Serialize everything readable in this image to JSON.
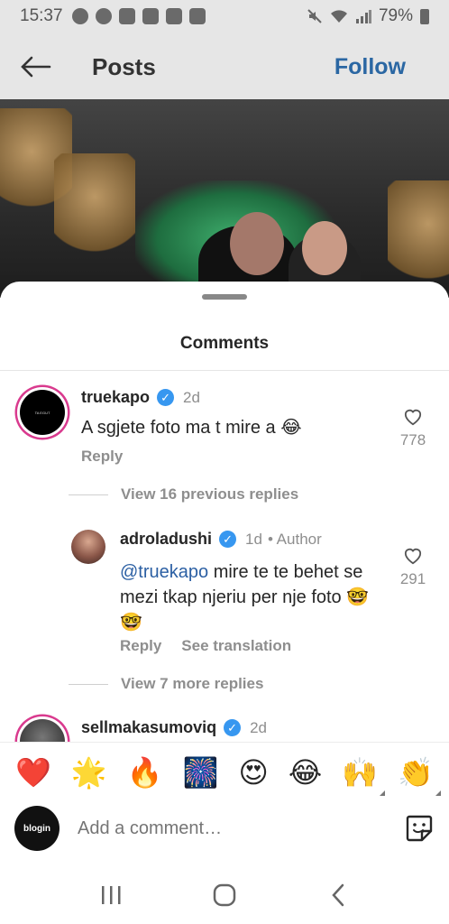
{
  "status_bar": {
    "time": "15:37",
    "battery": "79%"
  },
  "header": {
    "title": "Posts",
    "follow_label": "Follow"
  },
  "sheet": {
    "title": "Comments"
  },
  "comments": [
    {
      "username": "truekapo",
      "time": "2d",
      "text": "A sgjete foto ma t mire a 😂",
      "reply_label": "Reply",
      "likes": "778",
      "avatar_text": "TA EGUT",
      "view_replies": "View 16 previous replies"
    },
    {
      "username": "adroladushi",
      "time": "1d",
      "author_tag": "• Author",
      "mention": "@truekapo",
      "text": " mire te te behet se mezi tkap njeriu per nje foto 🤓🤓",
      "reply_label": "Reply",
      "translation_label": "See translation",
      "likes": "291",
      "view_replies": "View 7 more replies"
    },
    {
      "username": "sellmakasumoviq",
      "time": "2d"
    }
  ],
  "emoji_bar": [
    "❤️",
    "🌟",
    "🔥",
    "🎆",
    "😍",
    "😂",
    "🙌",
    "👏"
  ],
  "input": {
    "placeholder": "Add a comment…",
    "avatar_text": "blogin"
  },
  "colors": {
    "accent": "#3797f0",
    "follow": "#2b67a3",
    "mention": "#2b5fa3",
    "ring": "#d93a8e"
  }
}
